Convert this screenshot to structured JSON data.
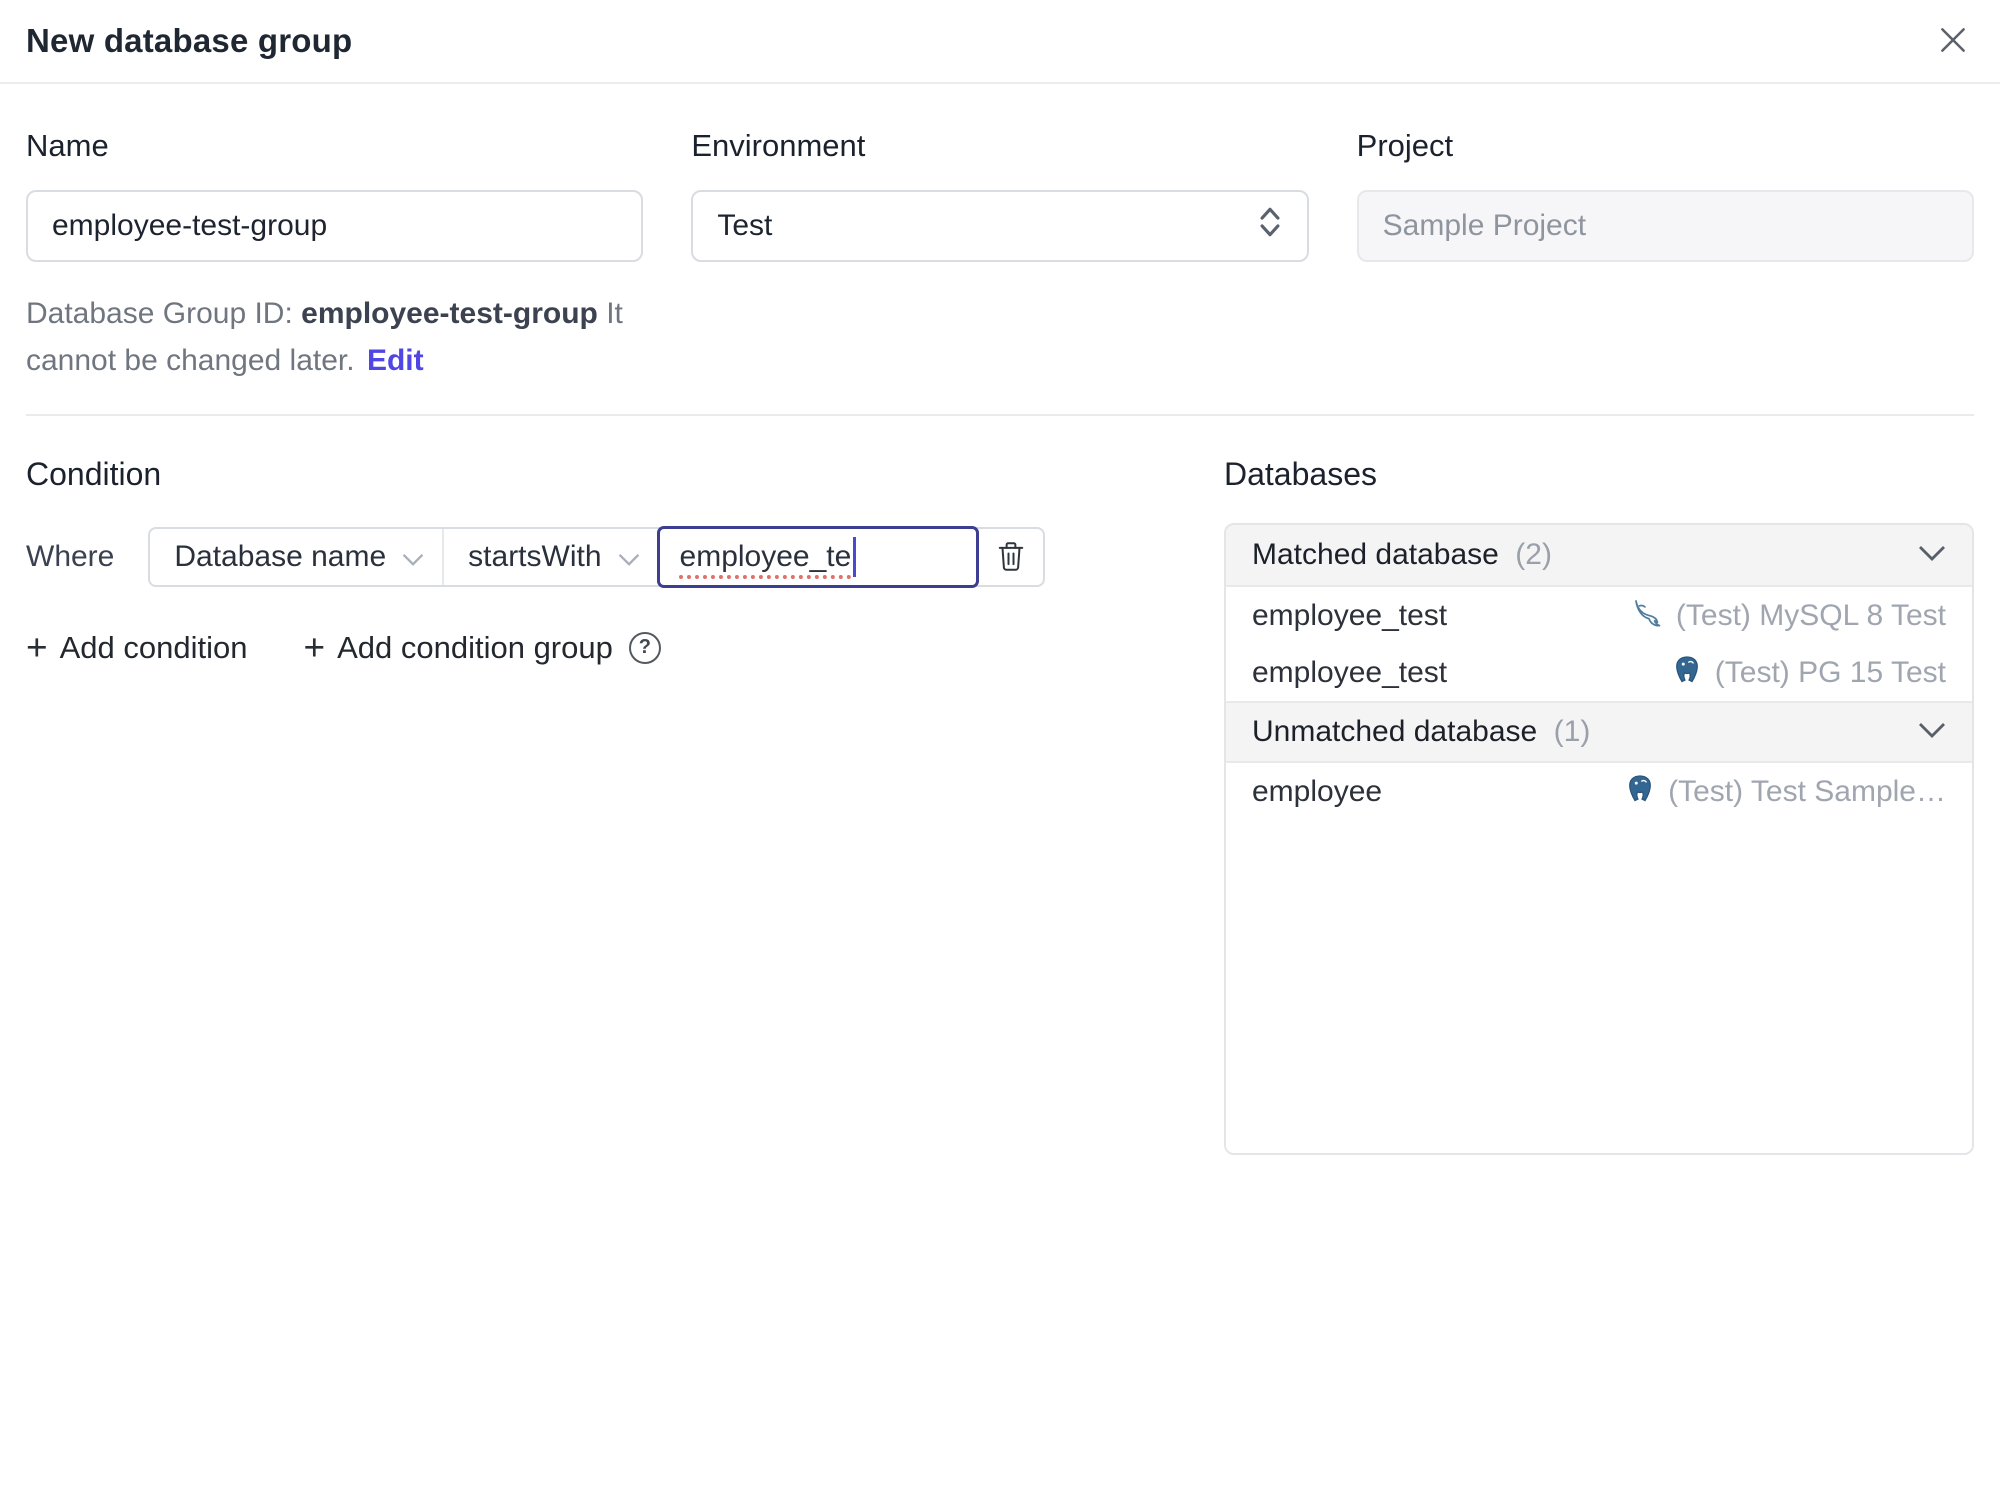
{
  "dialog": {
    "title": "New database group"
  },
  "form": {
    "name": {
      "label": "Name",
      "value": "employee-test-group"
    },
    "environment": {
      "label": "Environment",
      "value": "Test"
    },
    "project": {
      "label": "Project",
      "value": "Sample Project"
    },
    "hint": {
      "prefix": "Database Group ID: ",
      "id": "employee-test-group",
      "suffix": " It cannot be changed later.",
      "edit": "Edit"
    }
  },
  "condition": {
    "heading": "Condition",
    "where_label": "Where",
    "factor": "Database name",
    "operator": "startsWith",
    "value": "employee_te",
    "add_condition": "Add condition",
    "add_condition_group": "Add condition group"
  },
  "databases": {
    "heading": "Databases",
    "sections": [
      {
        "title": "Matched database",
        "count": "(2)",
        "rows": [
          {
            "name": "employee_test",
            "engine": "mysql",
            "instance": "(Test) MySQL 8 Test"
          },
          {
            "name": "employee_test",
            "engine": "postgres",
            "instance": "(Test) PG 15 Test"
          }
        ]
      },
      {
        "title": "Unmatched database",
        "count": "(1)",
        "rows": [
          {
            "name": "employee",
            "engine": "postgres",
            "instance": "(Test) Test Sample…"
          }
        ]
      }
    ]
  },
  "icons": {
    "plus": "+",
    "help": "?"
  },
  "colors": {
    "accent_link": "#4f46e5",
    "focus_border": "#3d3d92",
    "spellcheck_underline": "#df7168",
    "mysql_icon": "#4f7d9d",
    "postgres_icon": "#336791",
    "section_header_bg": "#f4f4f5",
    "muted_text": "#a0a6b0"
  }
}
